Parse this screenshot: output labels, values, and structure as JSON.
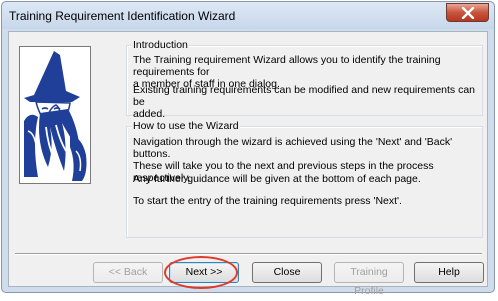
{
  "window": {
    "title": "Training Requirement Identification Wizard"
  },
  "introduction": {
    "heading": "Introduction",
    "para1_line1": "The Training requirement Wizard allows you to identify the training requirements for",
    "para1_line2": "a member of staff in one dialog.",
    "para2_line1": "Existing training requirements can be modified and new requirements can be",
    "para2_line2": "added."
  },
  "how_to": {
    "heading": "How to use the Wizard",
    "para1_line1": "Navigation through the wizard is achieved using the 'Next' and 'Back' buttons.",
    "para1_line2": "These will take you to the next and previous steps in the process respectively.",
    "para2": "Any further guidance will be given at the bottom of each page.",
    "para3": "To start the entry of the training requirements press 'Next'."
  },
  "buttons": {
    "back": "<< Back",
    "next": "Next >>",
    "close": "Close",
    "training_profile": "Training Profile",
    "help": "Help"
  },
  "colors": {
    "highlight": "#e23a2a",
    "wizard_blue": "#1f3f98"
  }
}
